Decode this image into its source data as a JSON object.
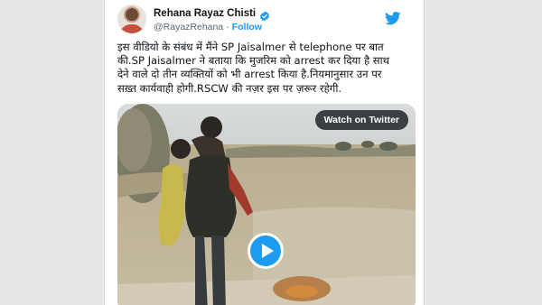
{
  "tweet": {
    "author": {
      "display_name": "Rehana Rayaz Chisti",
      "handle": "@RayazRehana",
      "separator": "·",
      "follow_label": "Follow",
      "avatar_icon": "profile-photo",
      "verified_icon": "verified-badge-icon"
    },
    "platform_icon": "twitter-bird-icon",
    "text_lines": [
      "इस वीडियो के संबंध में मैंने SP Jaisalmer से telephone पर बात",
      "की.SP Jaisalmer ने बताया कि मुजरिम को arrest कर दिया है साथ",
      "देने वाले दो तीन व्यक्तियों को भी arrest किया है.नियमानुसार उन पर",
      "सख़्त कार्यवाही होगी.RSCW की नज़र इस पर ज़रूर रहेगी."
    ],
    "media": {
      "watch_label": "Watch on Twitter",
      "play_icon": "play-icon"
    }
  },
  "colors": {
    "accent": "#1d9bf0",
    "text": "#0f1419",
    "secondary_text": "#536471",
    "background": "#e6e7e8"
  }
}
